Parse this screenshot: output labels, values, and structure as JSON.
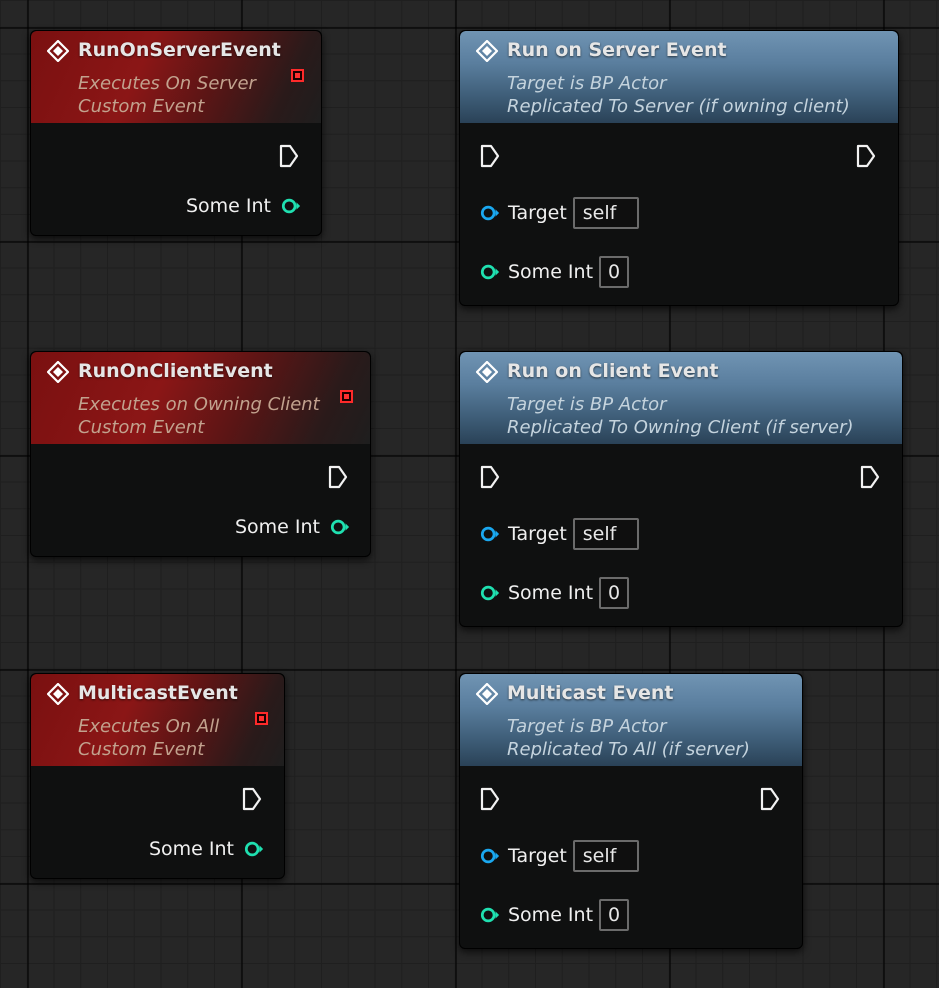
{
  "custom_events": [
    {
      "title": "RunOnServerEvent",
      "subtitle1": "Executes On Server",
      "subtitle2": "Custom Event",
      "pin_label": "Some Int"
    },
    {
      "title": "RunOnClientEvent",
      "subtitle1": "Executes on Owning Client",
      "subtitle2": "Custom Event",
      "pin_label": "Some Int"
    },
    {
      "title": "MulticastEvent",
      "subtitle1": "Executes On All",
      "subtitle2": "Custom Event",
      "pin_label": "Some Int"
    }
  ],
  "call_events": [
    {
      "title": "Run on Server Event",
      "subtitle1": "Target is BP Actor",
      "subtitle2": "Replicated To Server (if owning client)",
      "target_label": "Target",
      "target_value": "self",
      "int_label": "Some Int",
      "int_value": "0"
    },
    {
      "title": "Run on Client Event",
      "subtitle1": "Target is BP Actor",
      "subtitle2": "Replicated To Owning Client (if server)",
      "target_label": "Target",
      "target_value": "self",
      "int_label": "Some Int",
      "int_value": "0"
    },
    {
      "title": "Multicast Event",
      "subtitle1": "Target is BP Actor",
      "subtitle2": "Replicated To All (if server)",
      "target_label": "Target",
      "target_value": "self",
      "int_label": "Some Int",
      "int_value": "0"
    }
  ],
  "colors": {
    "event_header": "#8b1616",
    "call_header": "#5a7e9e",
    "int_pin": "#1fe0b0",
    "object_pin": "#1aa8f0",
    "replication_badge": "#ff2a2a"
  },
  "icons": {
    "event": "event-diamond-icon",
    "exec": "exec-pin-icon",
    "int_pin": "integer-pin-icon",
    "object_pin": "object-pin-icon",
    "replication": "replicated-event-icon"
  }
}
